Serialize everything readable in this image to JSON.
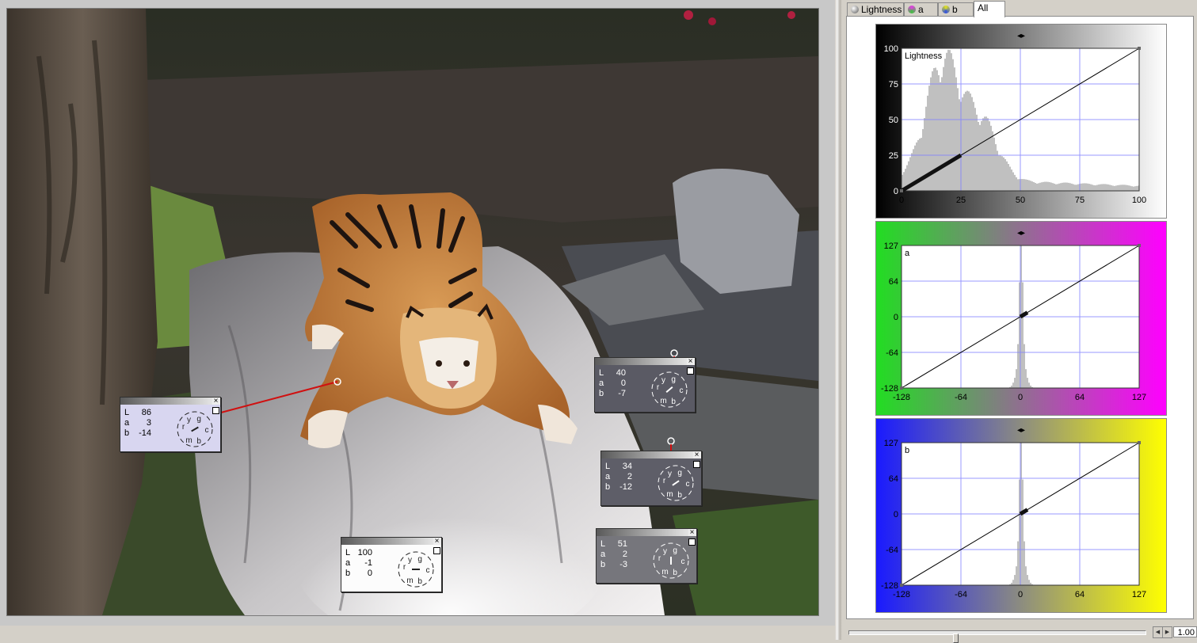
{
  "tabs": [
    {
      "label": "Lightness",
      "icon": "lightness-icon",
      "active": false
    },
    {
      "label": "a",
      "icon": "a-channel-icon",
      "active": false
    },
    {
      "label": "b",
      "icon": "b-channel-icon",
      "active": false
    },
    {
      "label": "All",
      "icon": "",
      "active": true
    }
  ],
  "probes": [
    {
      "L": "86",
      "a": "3",
      "b": "-14",
      "theme": "light"
    },
    {
      "L": "40",
      "a": "0",
      "b": "-7",
      "theme": "dark"
    },
    {
      "L": "34",
      "a": "2",
      "b": "-12",
      "theme": "dark"
    },
    {
      "L": "100",
      "a": "-1",
      "b": "0",
      "theme": "light"
    },
    {
      "L": "51",
      "a": "2",
      "b": "-3",
      "theme": "dark"
    }
  ],
  "probe_labels": {
    "L": "L",
    "a": "a",
    "b": "b"
  },
  "dial_letters": [
    "r",
    "y",
    "g",
    "c",
    "b",
    "m"
  ],
  "curves": [
    {
      "name": "Lightness",
      "channel_label": "Lightness",
      "x_ticks": [
        "0",
        "25",
        "50",
        "75",
        "100"
      ],
      "y_ticks": [
        "100",
        "75",
        "50",
        "25",
        "0"
      ],
      "colors": {
        "frame_left": "#000000",
        "frame_right": "#ffffff"
      }
    },
    {
      "name": "a",
      "channel_label": "a",
      "x_ticks": [
        "-128",
        "-64",
        "0",
        "64",
        "127"
      ],
      "y_ticks": [
        "127",
        "64",
        "0",
        "-64",
        "-128"
      ],
      "colors": {
        "frame_left": "#22dd22",
        "frame_right": "#ff00ff"
      }
    },
    {
      "name": "b",
      "channel_label": "b",
      "x_ticks": [
        "-128",
        "-64",
        "0",
        "64",
        "127"
      ],
      "y_ticks": [
        "127",
        "64",
        "0",
        "-64",
        "-128"
      ],
      "colors": {
        "frame_left": "#1a1aff",
        "frame_right": "#ffff00"
      }
    }
  ],
  "zoom": {
    "value": "1.00",
    "slider_fraction": 0.35
  }
}
